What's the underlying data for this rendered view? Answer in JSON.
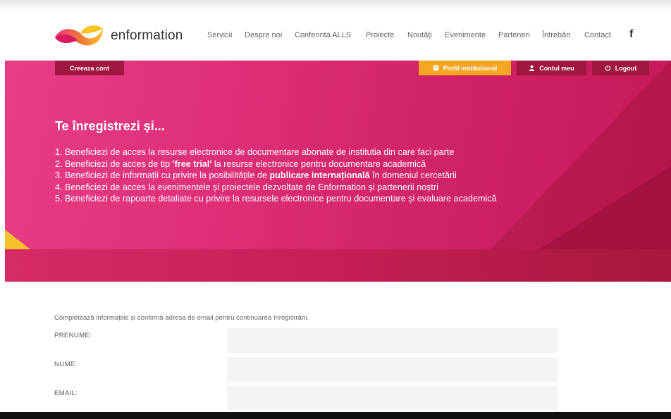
{
  "header": {
    "brand": "enformation",
    "nav": [
      {
        "label": "Servicii"
      },
      {
        "label": "Despre noi"
      },
      {
        "label": "Conferinta ALLS"
      },
      {
        "label": "Proiecte"
      },
      {
        "label": "Noutăți"
      },
      {
        "label": "Evenimente"
      },
      {
        "label": "Parteneri"
      },
      {
        "label": "Întrebări"
      },
      {
        "label": "Contact"
      }
    ],
    "social_icon": "f"
  },
  "banner": {
    "create_account": "Creeaza cont",
    "profil": "Profil institutional",
    "cont": "Contul meu",
    "logout": "Logout",
    "title": "Te înregistrezi și...",
    "benefits": {
      "b1": "1. Beneficiezi de acces la resurse electronice de documentare abonate de institutia din care faci parte",
      "b2_pre": "2. Beneficiezi de acces de tip ",
      "b2_bold": "'free trial'",
      "b2_post": " la resurse electronice pentru documentare academică",
      "b3_pre": "3. Beneficiezi de informații cu privire la posibilitățile de ",
      "b3_bold": "publicare internațională",
      "b3_post": " în domeniul cercetării",
      "b4": "4. Beneficiezi de acces la evenimentele și proiectele dezvoltate de Enformation și partenerii noștri",
      "b5": "5. Beneficiezi de rapoarte detaliate cu privire la resursele electronice pentru documentare și evaluare academică"
    }
  },
  "form": {
    "intro": "Completează informațiile și confirmă adresa de email pentru continuarea înregistrării.",
    "first_name_label": "PRENUME:",
    "last_name_label": "NUME:",
    "email_label": "EMAIL:",
    "first_name_value": "",
    "last_name_value": "",
    "email_value": ""
  },
  "colors": {
    "banner_pink": "#e0307a",
    "banner_dark": "#a0173f",
    "accent_orange": "#f5a623",
    "accent_yellow": "#f5c12a"
  }
}
